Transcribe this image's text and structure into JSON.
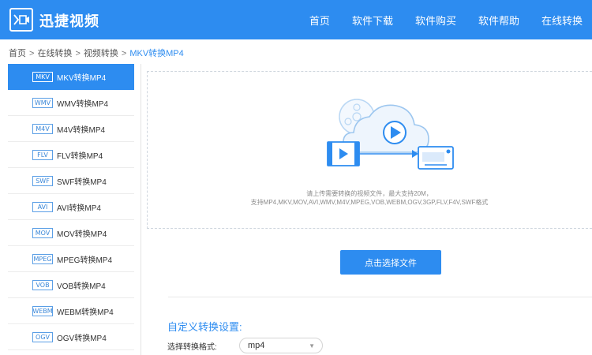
{
  "header": {
    "brand": "迅捷视频",
    "nav": [
      "首页",
      "软件下载",
      "软件购买",
      "软件帮助",
      "在线转换"
    ]
  },
  "breadcrumb": {
    "items": [
      "首页",
      "在线转换",
      "视频转换",
      "MKV转换MP4"
    ],
    "separator": ">"
  },
  "sidebar": {
    "items": [
      {
        "tag": "MKV",
        "label": "MKV转换MP4"
      },
      {
        "tag": "WMV",
        "label": "WMV转换MP4"
      },
      {
        "tag": "M4V",
        "label": "M4V转换MP4"
      },
      {
        "tag": "FLV",
        "label": "FLV转换MP4"
      },
      {
        "tag": "SWF",
        "label": "SWF转换MP4"
      },
      {
        "tag": "AVI",
        "label": "AVI转换MP4"
      },
      {
        "tag": "MOV",
        "label": "MOV转换MP4"
      },
      {
        "tag": "MPEG",
        "label": "MPEG转换MP4"
      },
      {
        "tag": "VOB",
        "label": "VOB转换MP4"
      },
      {
        "tag": "WEBM",
        "label": "WEBM转换MP4"
      },
      {
        "tag": "OGV",
        "label": "OGV转换MP4"
      }
    ]
  },
  "upload": {
    "hint_line1": "请上传需要转换的视频文件，最大支持20M，",
    "hint_line2": "支持MP4,MKV,MOV,AVI,WMV,M4V,MPEG,VOB,WEBM,OGV,3GP,FLV,F4V,SWF格式",
    "button_label": "点击选择文件"
  },
  "settings": {
    "title": "自定义转换设置:",
    "format_label": "选择转换格式:",
    "format_value": "mp4"
  },
  "colors": {
    "primary": "#2d8cf0",
    "active_item": "#2d8cf0"
  }
}
